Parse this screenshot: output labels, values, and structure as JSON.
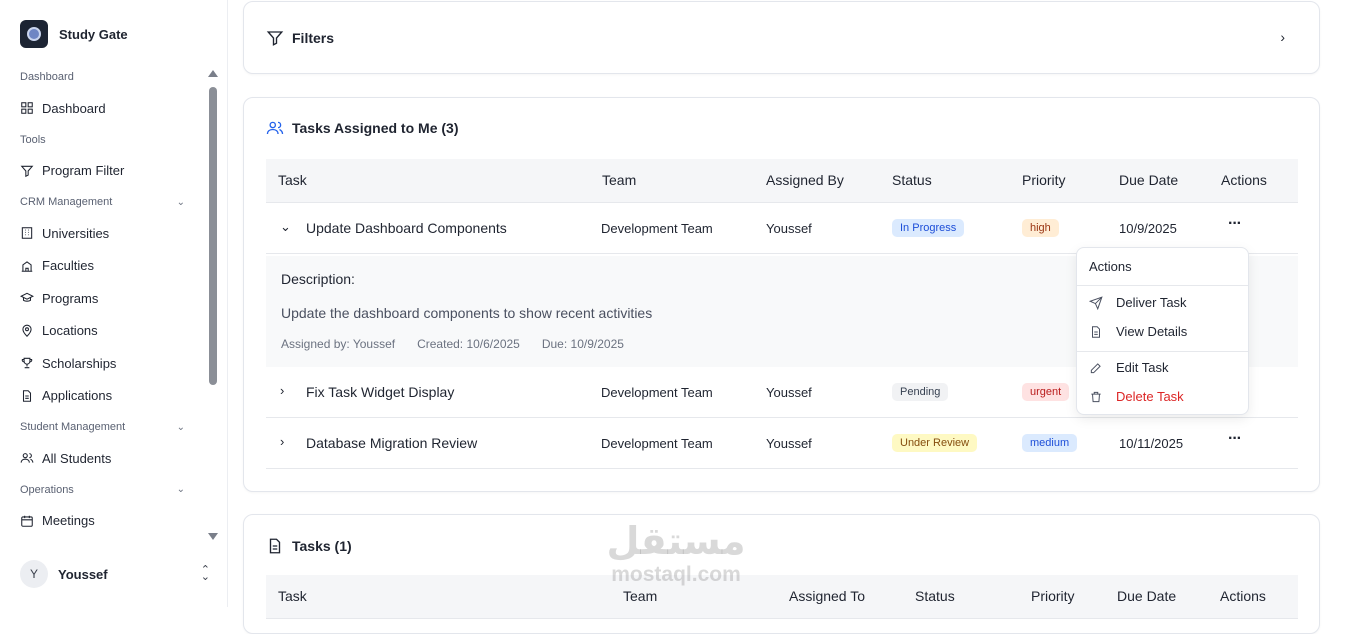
{
  "brand": {
    "name": "Study Gate"
  },
  "sidebar": {
    "sections": [
      {
        "label": "Dashboard",
        "collapsible": false,
        "items": [
          {
            "label": "Dashboard",
            "icon": "grid-icon"
          }
        ]
      },
      {
        "label": "Tools",
        "collapsible": false,
        "items": [
          {
            "label": "Program Filter",
            "icon": "filter-icon"
          }
        ]
      },
      {
        "label": "CRM Management",
        "collapsible": true,
        "items": [
          {
            "label": "Universities",
            "icon": "building-icon"
          },
          {
            "label": "Faculties",
            "icon": "school-icon"
          },
          {
            "label": "Programs",
            "icon": "graduation-cap-icon"
          },
          {
            "label": "Locations",
            "icon": "map-pin-icon"
          },
          {
            "label": "Scholarships",
            "icon": "trophy-icon"
          },
          {
            "label": "Applications",
            "icon": "file-icon"
          }
        ]
      },
      {
        "label": "Student Management",
        "collapsible": true,
        "items": [
          {
            "label": "All Students",
            "icon": "users-icon"
          }
        ]
      },
      {
        "label": "Operations",
        "collapsible": true,
        "items": [
          {
            "label": "Meetings",
            "icon": "calendar-icon"
          }
        ]
      }
    ],
    "user": {
      "initial": "Y",
      "name": "Youssef"
    }
  },
  "filters": {
    "title": "Filters"
  },
  "assigned": {
    "title": "Tasks Assigned to Me (3)",
    "headers": {
      "task": "Task",
      "team": "Team",
      "assigned_by": "Assigned By",
      "status": "Status",
      "priority": "Priority",
      "due": "Due Date",
      "actions": "Actions"
    },
    "rows": [
      {
        "task": "Update Dashboard Components",
        "team": "Development Team",
        "assigned_by": "Youssef",
        "status": "In Progress",
        "priority": "high",
        "due": "10/9/2025",
        "expanded": true
      },
      {
        "task": "Fix Task Widget Display",
        "team": "Development Team",
        "assigned_by": "Youssef",
        "status": "Pending",
        "priority": "urgent",
        "due": "",
        "expanded": false
      },
      {
        "task": "Database Migration Review",
        "team": "Development Team",
        "assigned_by": "Youssef",
        "status": "Under Review",
        "priority": "medium",
        "due": "10/11/2025",
        "expanded": false
      }
    ],
    "description": {
      "heading": "Description:",
      "text": "Update the dashboard components to show recent activities",
      "assigned_by": "Assigned by: Youssef",
      "created": "Created: 10/6/2025",
      "due": "Due: 10/9/2025"
    }
  },
  "actions_menu": {
    "title": "Actions",
    "items": [
      {
        "label": "Deliver Task",
        "icon": "send-icon"
      },
      {
        "label": "View Details",
        "icon": "file-text-icon"
      },
      {
        "label": "Edit Task",
        "icon": "edit-icon"
      },
      {
        "label": "Delete Task",
        "icon": "trash-icon",
        "color": "#dc2626"
      }
    ]
  },
  "tasks": {
    "title": "Tasks (1)",
    "headers": {
      "task": "Task",
      "team": "Team",
      "assigned_to": "Assigned To",
      "status": "Status",
      "priority": "Priority",
      "due": "Due Date",
      "actions": "Actions"
    }
  },
  "watermark": {
    "arabic": "مستقل",
    "latin": "mostaql.com"
  },
  "colors": {
    "in_progress_bg": "#dbeafe",
    "in_progress_fg": "#1d4ed8",
    "pending_bg": "#f1f2f4",
    "pending_fg": "#374151",
    "review_bg": "#fef9c3",
    "review_fg": "#854d0e",
    "high_bg": "#ffedd5",
    "high_fg": "#9a3412",
    "urgent_bg": "#fee2e2",
    "urgent_fg": "#b91c1c",
    "medium_bg": "#dbeafe",
    "medium_fg": "#1d4ed8",
    "accent_blue": "#2563eb"
  }
}
